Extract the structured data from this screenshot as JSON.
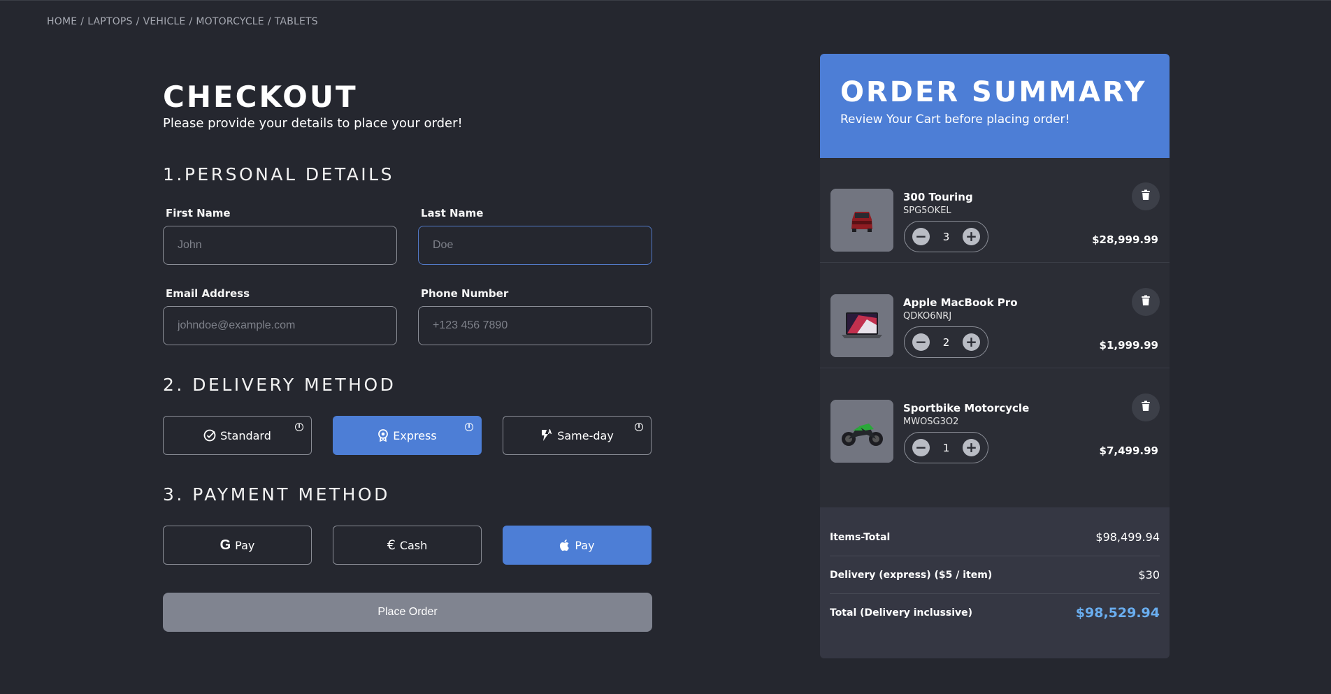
{
  "breadcrumb": [
    "HOME",
    "LAPTOPS",
    "VEHICLE",
    "MOTORCYCLE",
    "TABLETS"
  ],
  "breadcrumb_separator": "/",
  "checkout": {
    "title": "CHECKOUT",
    "subtitle": "Please provide your details to place your order!"
  },
  "personal": {
    "section_title": "1.PERSONAL DETAILS",
    "first_name": {
      "label": "First Name",
      "placeholder": "John",
      "value": ""
    },
    "last_name": {
      "label": "Last Name",
      "placeholder": "Doe",
      "value": ""
    },
    "email": {
      "label": "Email Address",
      "placeholder": "johndoe@example.com",
      "value": ""
    },
    "phone": {
      "label": "Phone Number",
      "placeholder": "+123 456 7890",
      "value": ""
    }
  },
  "delivery": {
    "section_title": "2. DELIVERY METHOD",
    "options": [
      {
        "label": "Standard",
        "icon": "check-circle-icon",
        "active": false
      },
      {
        "label": "Express",
        "icon": "award-badge-icon",
        "active": true
      },
      {
        "label": "Same-day",
        "icon": "lightning-icon",
        "active": false
      }
    ],
    "info_glyph": "i"
  },
  "payment": {
    "section_title": "3. PAYMENT METHOD",
    "options": [
      {
        "label": "Pay",
        "icon": "google-icon",
        "icon_text": "G",
        "active": false
      },
      {
        "label": "Cash",
        "icon": "euro-icon",
        "icon_text": "€",
        "active": false
      },
      {
        "label": "Pay",
        "icon": "apple-icon",
        "active": true
      }
    ]
  },
  "place_order_label": "Place Order",
  "summary": {
    "title": "ORDER SUMMARY",
    "subtitle": "Review Your Cart before placing order!",
    "items": [
      {
        "name": "300 Touring",
        "sku": "SPG5OKEL",
        "qty": "3",
        "price": "$28,999.99",
        "image": "red-car-thumbnail"
      },
      {
        "name": "Apple MacBook Pro",
        "sku": "QDKO6NRJ",
        "qty": "2",
        "price": "$1,999.99",
        "image": "laptop-thumbnail"
      },
      {
        "name": "Sportbike Motorcycle",
        "sku": "MWOSG3O2",
        "qty": "1",
        "price": "$7,499.99",
        "image": "motorcycle-thumbnail"
      }
    ],
    "qty_minus": "−",
    "qty_plus": "+",
    "totals": {
      "items_total_label": "Items-Total",
      "items_total_value": "$98,499.94",
      "delivery_label": "Delivery (express) ($5 / item)",
      "delivery_value": "$30",
      "grand_label": "Total (Delivery inclussive)",
      "grand_value": "$98,529.94"
    }
  },
  "colors": {
    "background": "#25272f",
    "accent": "#4d7ed6",
    "grand_total": "#6aaef0",
    "place_order_disabled": "#808490"
  }
}
